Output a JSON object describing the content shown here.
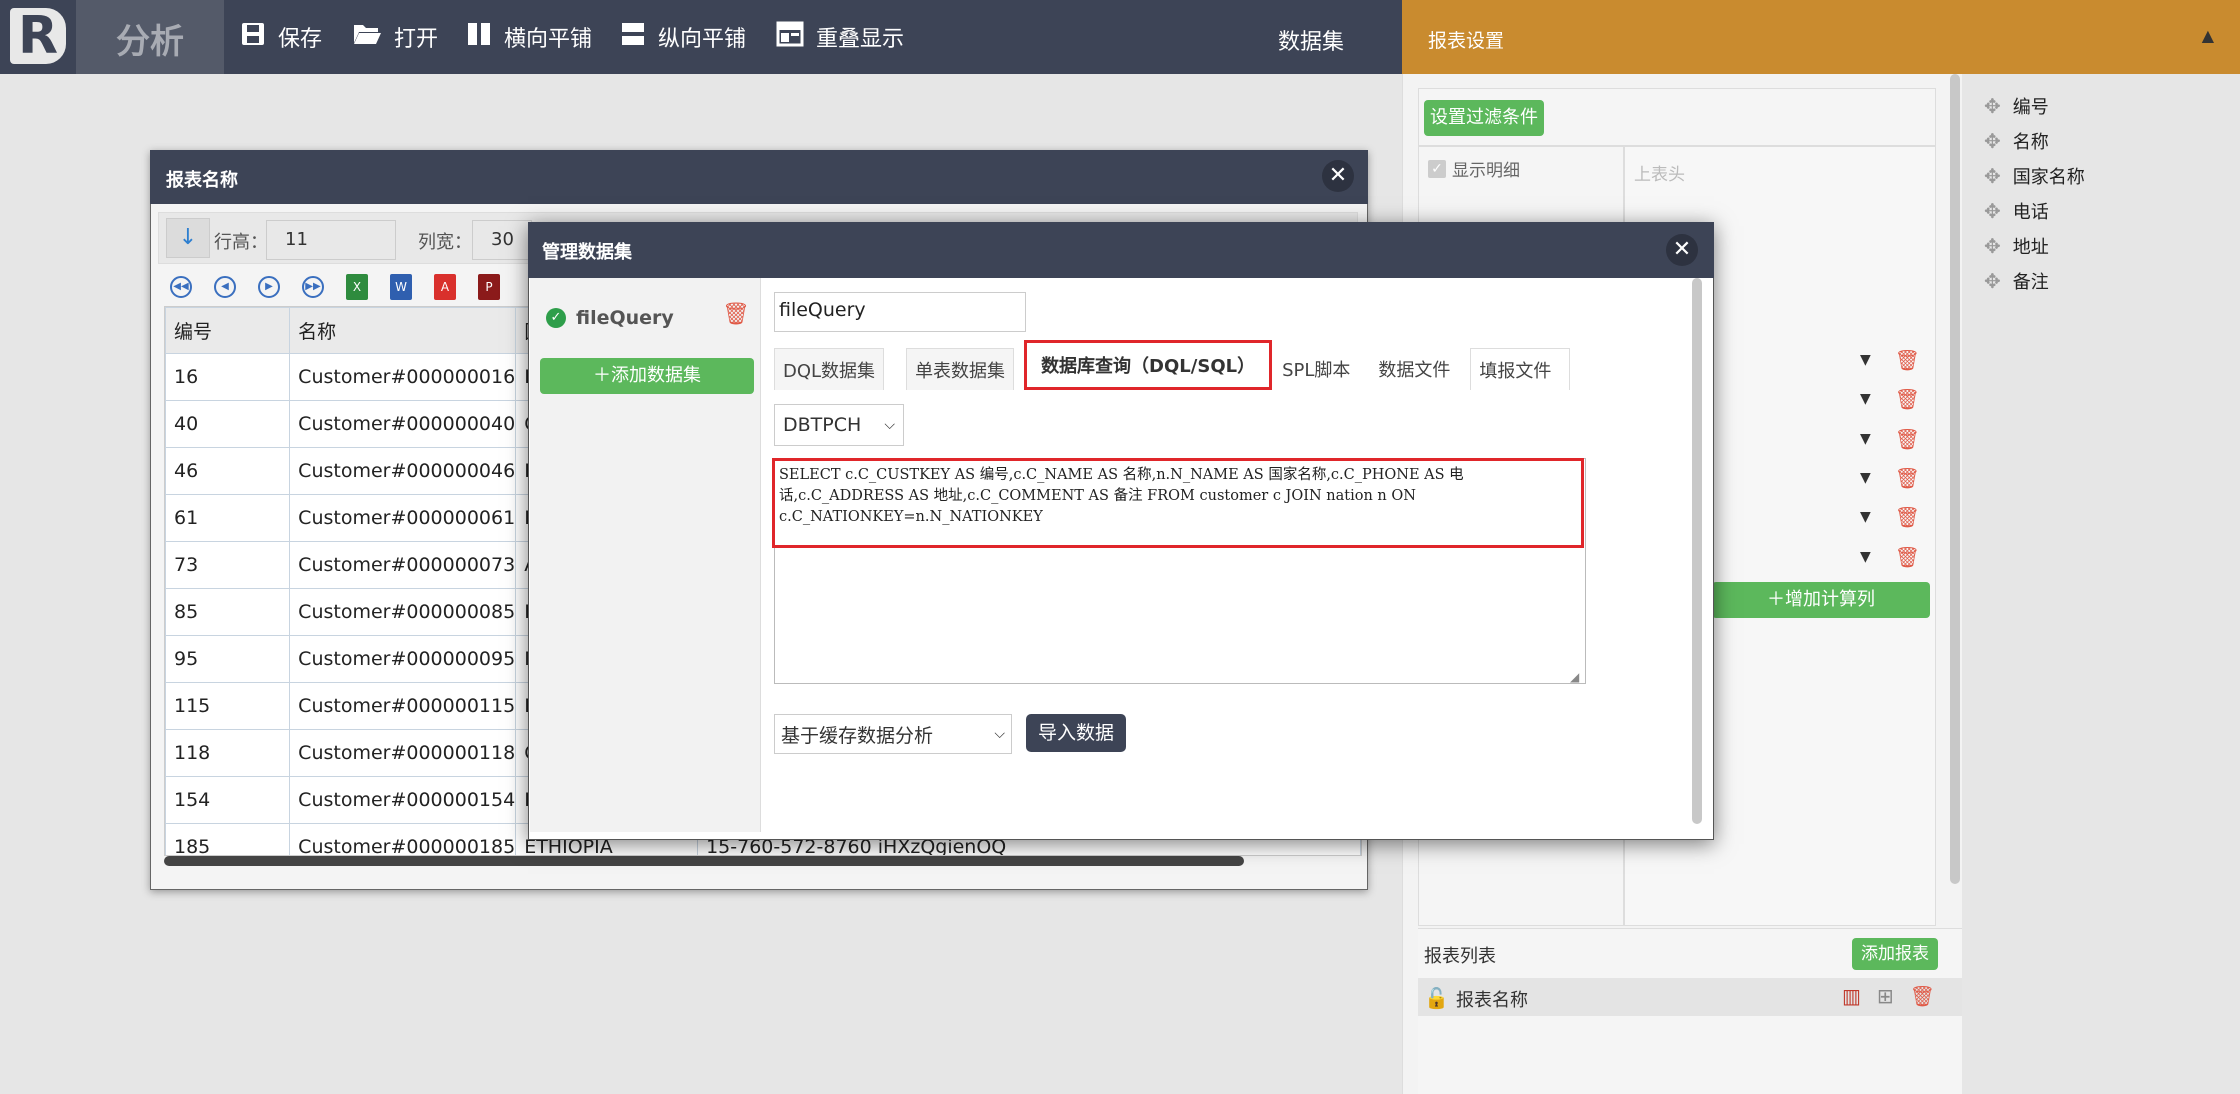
{
  "topbar": {
    "logo_letter": "R",
    "module": "分析",
    "buttons": [
      {
        "icon": "save-icon",
        "label": "保存"
      },
      {
        "icon": "folder-open-icon",
        "label": "打开"
      },
      {
        "icon": "tile-horizontal-icon",
        "label": "横向平铺"
      },
      {
        "icon": "tile-vertical-icon",
        "label": "纵向平铺"
      },
      {
        "icon": "overlap-icon",
        "label": "重叠显示"
      }
    ],
    "dataset_label": "数据集"
  },
  "settings": {
    "title": "报表设置",
    "filter_button": "设置过滤条件",
    "show_detail": "显示明细",
    "header_placeholder": "上表头",
    "add_calc_column": "增加计算列",
    "report_list_title": "报表列表",
    "add_report_button": "添加报表",
    "report_item": "报表名称"
  },
  "fields": [
    "编号",
    "名称",
    "国家名称",
    "电话",
    "地址",
    "备注"
  ],
  "report_window": {
    "title": "报表名称",
    "row_height_label": "行高：",
    "row_height_value": "11",
    "col_width_label": "列宽：",
    "col_width_value": "30",
    "columns": [
      "编号",
      "名称",
      "国家"
    ],
    "rows": [
      [
        "16",
        "Customer#000000016",
        "IRA"
      ],
      [
        "40",
        "Customer#000000040",
        "CA"
      ],
      [
        "46",
        "Customer#000000046",
        "FRA"
      ],
      [
        "61",
        "Customer#000000061",
        "PEI"
      ],
      [
        "73",
        "Customer#000000073",
        "ALG"
      ],
      [
        "85",
        "Customer#000000085",
        "ETH"
      ],
      [
        "95",
        "Customer#000000095",
        "MO"
      ],
      [
        "115",
        "Customer#000000115",
        "IND"
      ],
      [
        "118",
        "Customer#000000118",
        "CHI"
      ],
      [
        "154",
        "Customer#000000154",
        "RO"
      ],
      [
        "185",
        "Customer#000000185",
        "ETHIOPIA"
      ]
    ],
    "partial_row_extra": "15-760-572-8760  iHXzQgienOQ"
  },
  "modal": {
    "title": "管理数据集",
    "dataset_name": "fileQuery",
    "add_dataset_button": "添加数据集",
    "query_name_value": "fileQuery",
    "tabs": [
      "DQL数据集",
      "单表数据集",
      "数据库查询（DQL/SQL）",
      "SPL脚本",
      "数据文件",
      "填报文件"
    ],
    "active_tab": "数据库查询（DQL/SQL）",
    "db_select": "DBTPCH",
    "sql": "SELECT c.C_CUSTKEY AS 编号,c.C_NAME AS 名称,n.N_NAME AS 国家名称,c.C_PHONE AS 电话,c.C_ADDRESS AS 地址,c.C_COMMENT AS 备注 FROM customer c JOIN nation n ON c.C_NATIONKEY=n.N_NATIONKEY",
    "cache_select": "基于缓存数据分析",
    "import_button": "导入数据"
  },
  "colors": {
    "topbar": "#3d4456",
    "settings_header": "#c98b2f",
    "green": "#5cb85c",
    "highlight_red": "#e0262a"
  }
}
